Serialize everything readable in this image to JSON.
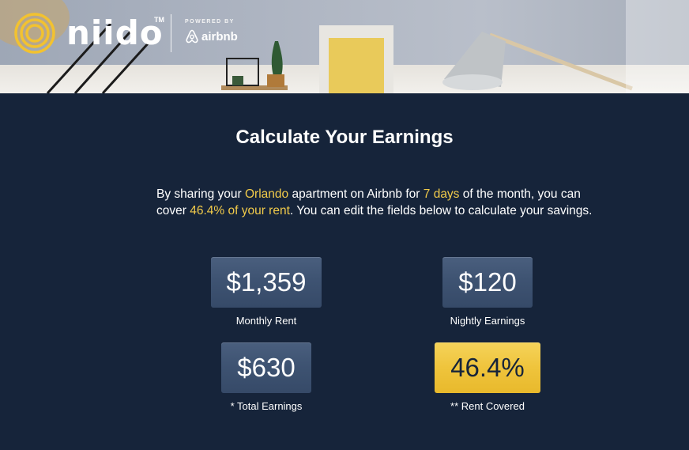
{
  "header": {
    "brand": "niido",
    "trademark": "TM",
    "powered_by": "POWERED BY",
    "partner": "airbnb"
  },
  "main": {
    "title": "Calculate Your Earnings",
    "intro": {
      "part1": "By sharing your ",
      "city": "Orlando",
      "part2": " apartment on Airbnb for ",
      "days": "7 days",
      "part3": " of the month, you can cover ",
      "percent_text": "46.4% of your rent",
      "part4": ". You can edit the fields below to calculate your savings."
    },
    "stats": {
      "monthly_rent": {
        "value": "$1,359",
        "label": "Monthly Rent"
      },
      "nightly_earnings": {
        "value": "$120",
        "label": "Nightly Earnings"
      },
      "total_earnings": {
        "value": "$630",
        "label": "* Total Earnings"
      },
      "rent_covered": {
        "value": "46.4%",
        "label": "** Rent Covered"
      }
    }
  },
  "colors": {
    "background": "#16243a",
    "highlight": "#f2cb4a",
    "stat_box": "#3e5372",
    "gold_box": "#efc43c"
  }
}
